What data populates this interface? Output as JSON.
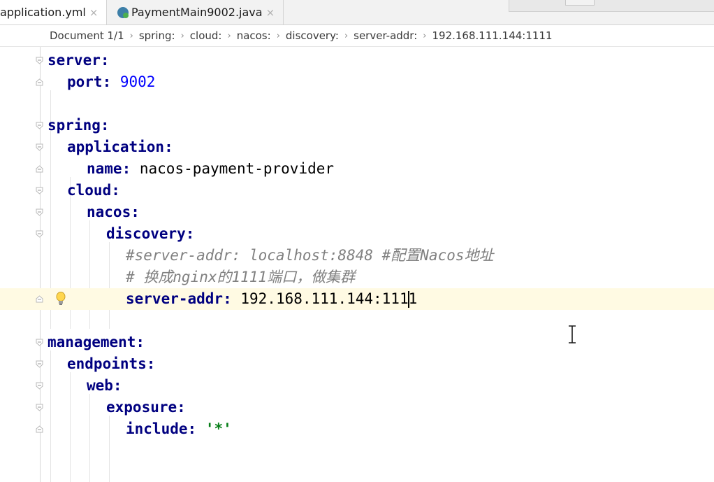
{
  "tabs": [
    {
      "label": "application.yml",
      "close": "×",
      "active": true
    },
    {
      "label": "PaymentMain9002.java",
      "close": "×",
      "active": false,
      "icon": "java-class-icon"
    }
  ],
  "breadcrumb": [
    "Document 1/1",
    "spring:",
    "cloud:",
    "nacos:",
    "discovery:",
    "server-addr:",
    "192.168.111.144:1111"
  ],
  "breadcrumb_separator": "›",
  "code": {
    "server_key": "server:",
    "port_key": "port:",
    "port_value": "9002",
    "spring_key": "spring:",
    "application_key": "application:",
    "name_key": "name:",
    "name_value": "nacos-payment-provider",
    "cloud_key": "cloud:",
    "nacos_key": "nacos:",
    "discovery_key": "discovery:",
    "comment1": "#server-addr: localhost:8848 #配置Nacos地址",
    "comment2": "# 换成nginx的1111端口，做集群",
    "server_addr_key": "server-addr:",
    "server_addr_value_a": "192.168.111.144:111",
    "server_addr_value_b": "1",
    "management_key": "management:",
    "endpoints_key": "endpoints:",
    "web_key": "web:",
    "exposure_key": "exposure:",
    "include_key": "include:",
    "include_value": "'*'"
  },
  "current_line": 12,
  "colors": {
    "key": "#000080",
    "number": "#0000ff",
    "string": "#067d17",
    "comment": "#808080",
    "current_line_bg": "#fffae3"
  }
}
